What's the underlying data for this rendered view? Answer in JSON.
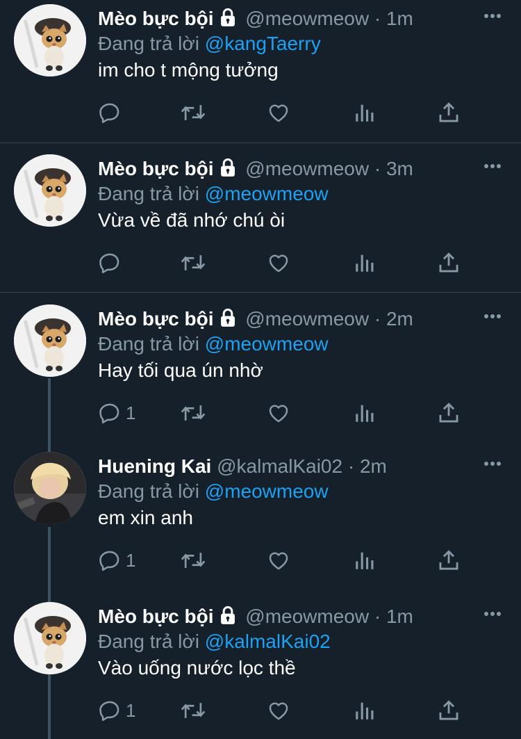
{
  "tweets": [
    {
      "name": "Mèo bực bội",
      "handle": "@meowmeow",
      "dot": "·",
      "time": "1m",
      "reply_prefix": "Đang trả lời",
      "reply_to": "@kangTaerry",
      "text": "im cho t mộng tưởng",
      "reply_count": "",
      "locked": true,
      "avatar": "cat"
    },
    {
      "name": "Mèo bực bội",
      "handle": "@meowmeow",
      "dot": "·",
      "time": "3m",
      "reply_prefix": "Đang trả lời",
      "reply_to": "@meowmeow",
      "text": "Vừa về đã nhớ chú òi",
      "reply_count": "",
      "locked": true,
      "avatar": "cat"
    },
    {
      "name": "Mèo bực bội",
      "handle": "@meowmeow",
      "dot": "·",
      "time": "2m",
      "reply_prefix": "Đang trả lời",
      "reply_to": "@meowmeow",
      "text": "Hay tối qua ún nhờ",
      "reply_count": "1",
      "locked": true,
      "avatar": "cat"
    },
    {
      "name": "Huening Kai",
      "handle": "@kalmalKai02",
      "dot": "·",
      "time": "2m",
      "reply_prefix": "Đang trả lời",
      "reply_to": "@meowmeow",
      "text": "em xin anh",
      "reply_count": "1",
      "locked": false,
      "avatar": "person"
    },
    {
      "name": "Mèo bực bội",
      "handle": "@meowmeow",
      "dot": "·",
      "time": "1m",
      "reply_prefix": "Đang trả lời",
      "reply_to": "@kalmalKai02",
      "text": "Vào uống nước lọc thề",
      "reply_count": "1",
      "locked": true,
      "avatar": "cat"
    }
  ],
  "icons": {
    "reply": "reply-icon",
    "retweet": "retweet-icon",
    "like": "like-icon",
    "analytics": "analytics-icon",
    "share": "share-icon",
    "more": "more-icon",
    "lock": "lock-icon"
  },
  "colors": {
    "background": "#15202b",
    "text": "#ffffff",
    "muted": "#8899a6",
    "mention": "#1da1f2",
    "divider": "#38444d"
  }
}
